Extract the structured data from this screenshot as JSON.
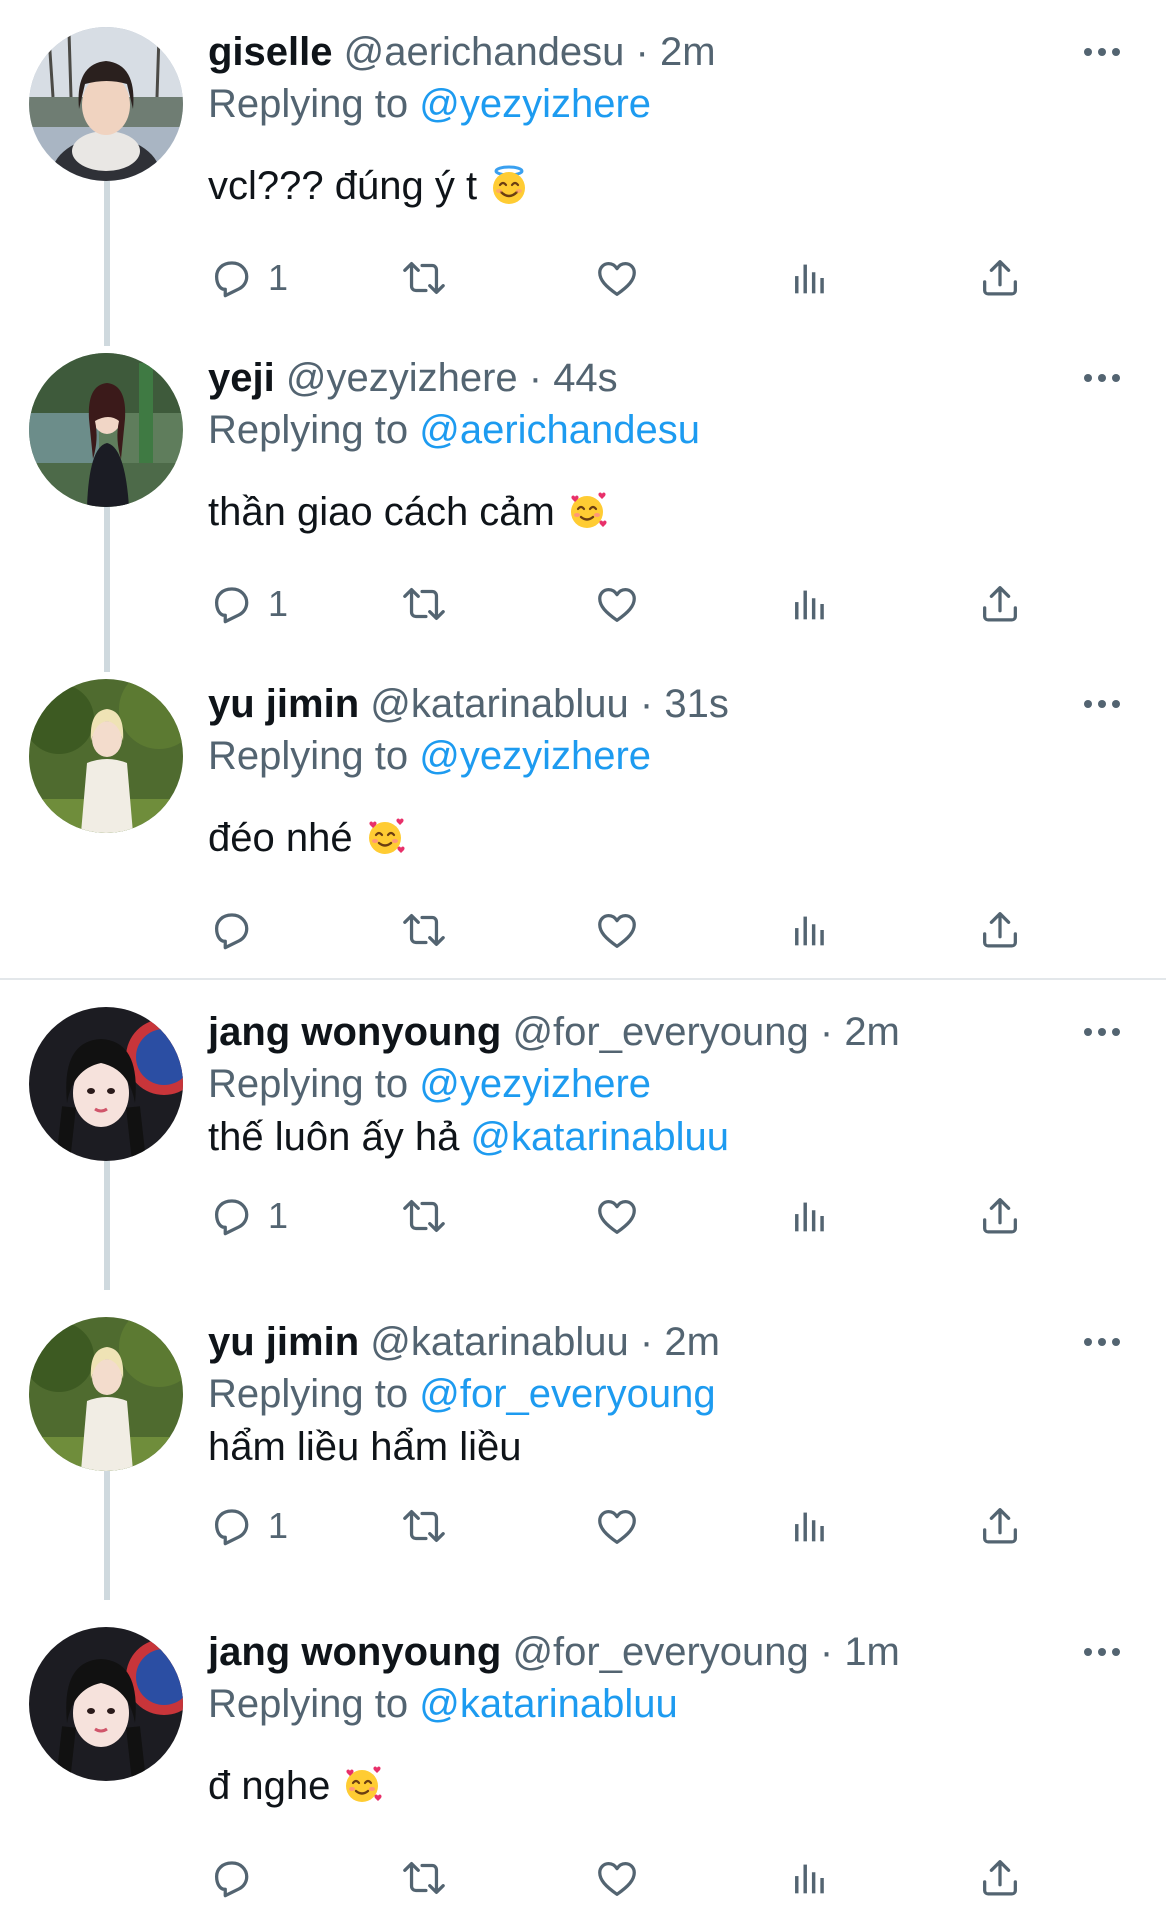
{
  "colors": {
    "link": "#1d9bf0",
    "meta": "#536471",
    "text": "#0f1419",
    "line": "#cfd9de"
  },
  "groups": [
    {
      "tweets": [
        {
          "name": "giselle",
          "handle": "@aerichandesu",
          "sep": " · ",
          "time": "2m",
          "replying_prefix": "Replying to ",
          "replying_to": "@yezyizhere",
          "text": "vcl??? đúng ý t",
          "emoji": "smiling-face-with-halo-icon",
          "reply_count": "1"
        },
        {
          "name": "yeji",
          "handle": "@yezyizhere",
          "sep": " · ",
          "time": "44s",
          "replying_prefix": "Replying to ",
          "replying_to": "@aerichandesu",
          "text": "thần giao cách cảm",
          "emoji": "smiling-face-with-hearts-icon",
          "reply_count": "1"
        },
        {
          "name": "yu jimin",
          "handle": "@katarinabluu",
          "sep": " · ",
          "time": "31s",
          "replying_prefix": "Replying to ",
          "replying_to": "@yezyizhere",
          "text": "đéo nhé",
          "emoji": "smiling-face-with-hearts-icon",
          "reply_count": ""
        }
      ]
    },
    {
      "tweets": [
        {
          "name": "jang wonyoung",
          "handle": "@for_everyoung",
          "sep": " · ",
          "time": "2m",
          "replying_prefix": "Replying to ",
          "replying_to": "@yezyizhere",
          "text": "thế luôn ấy hả ",
          "text_mention": "@katarinabluu",
          "reply_count": "1"
        },
        {
          "name": "yu jimin",
          "handle": "@katarinabluu",
          "sep": " · ",
          "time": "2m",
          "replying_prefix": "Replying to ",
          "replying_to": "@for_everyoung",
          "text": "hẩm liều hẩm liều",
          "reply_count": "1"
        },
        {
          "name": "jang wonyoung",
          "handle": "@for_everyoung",
          "sep": " · ",
          "time": "1m",
          "replying_prefix": "Replying to ",
          "replying_to": "@katarinabluu",
          "text": "đ nghe",
          "emoji": "smiling-face-with-hearts-icon",
          "reply_count": ""
        }
      ]
    }
  ]
}
